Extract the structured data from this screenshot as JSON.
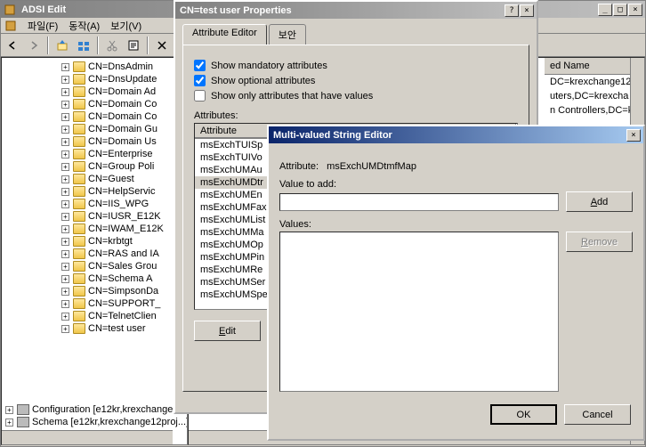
{
  "main": {
    "title": "ADSI Edit",
    "menu": {
      "file": "파일(F)",
      "action": "동작(A)",
      "view": "보기(V)"
    }
  },
  "tree": {
    "items": [
      "CN=DnsAdmin",
      "CN=DnsUpdate",
      "CN=Domain Ad",
      "CN=Domain Co",
      "CN=Domain Co",
      "CN=Domain Gu",
      "CN=Domain Us",
      "CN=Enterprise",
      "CN=Group Poli",
      "CN=Guest",
      "CN=HelpServic",
      "CN=IIS_WPG",
      "CN=IUSR_E12K",
      "CN=IWAM_E12K",
      "CN=krbtgt",
      "CN=RAS and IA",
      "CN=Sales Grou",
      "CN=Schema A",
      "CN=SimpsonDa",
      "CN=SUPPORT_",
      "CN=TelnetClien",
      "CN=test user"
    ],
    "bottom": [
      "Configuration [e12kr,krexchange...",
      "Schema [e12kr,krexchange12proj...]"
    ]
  },
  "list": {
    "header": "ed Name",
    "rows": [
      "DC=krexchange12p",
      "uters,DC=krexcha",
      "n Controllers,DC=k"
    ]
  },
  "props": {
    "title": "CN=test user Properties",
    "tabs": {
      "attr": "Attribute Editor",
      "sec": "보안"
    },
    "check1": "Show mandatory attributes",
    "check2": "Show optional attributes",
    "check3": "Show only attributes that have values",
    "attributes_label": "Attributes:",
    "col_header": "Attribute",
    "rows": [
      "msExchTUISp",
      "msExchTUIVo",
      "msExchUMAu",
      "msExchUMDtr",
      "msExchUMEn",
      "msExchUMFax",
      "msExchUMList",
      "msExchUMMa",
      "msExchUMOp",
      "msExchUMPin",
      "msExchUMRe",
      "msExchUMSer",
      "msExchUMSpe"
    ],
    "edit_btn": "Edit"
  },
  "editor": {
    "title": "Multi-valued String Editor",
    "attr_label": "Attribute:",
    "attr_value": "msExchUMDtmfMap",
    "value_label": "Value to add:",
    "values_label": "Values:",
    "add_btn": "Add",
    "remove_btn": "Remove",
    "ok_btn": "OK",
    "cancel_btn": "Cancel"
  }
}
